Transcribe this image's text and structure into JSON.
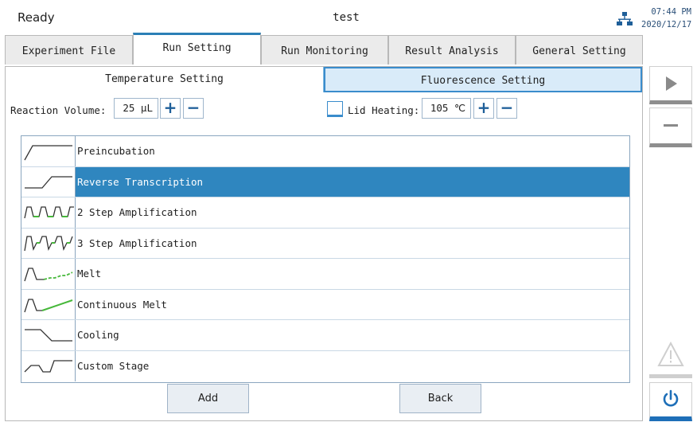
{
  "titlebar": {
    "status": "Ready",
    "title": "test",
    "time": "07:44 PM",
    "date": "2020/12/17"
  },
  "main_tabs": [
    {
      "label": "Experiment File"
    },
    {
      "label": "Run Setting"
    },
    {
      "label": "Run Monitoring"
    },
    {
      "label": "Result Analysis"
    },
    {
      "label": "General Setting"
    }
  ],
  "sub_tabs": {
    "temperature": "Temperature Setting",
    "fluorescence": "Fluorescence Setting"
  },
  "reaction": {
    "label": "Reaction Volume:",
    "value": "25 μL",
    "plus": "+",
    "minus": "−"
  },
  "lid": {
    "label": "Lid Heating:",
    "value": "105 ℃",
    "plus": "+",
    "minus": "−",
    "checked": false
  },
  "stages": [
    {
      "label": "Preincubation",
      "icon": "preincubation-profile-icon",
      "selected": false
    },
    {
      "label": "Reverse Transcription",
      "icon": "reverse-transcription-profile-icon",
      "selected": true
    },
    {
      "label": "2 Step Amplification",
      "icon": "two-step-amplification-profile-icon",
      "selected": false
    },
    {
      "label": "3 Step Amplification",
      "icon": "three-step-amplification-profile-icon",
      "selected": false
    },
    {
      "label": "Melt",
      "icon": "melt-profile-icon",
      "selected": false
    },
    {
      "label": "Continuous Melt",
      "icon": "continuous-melt-profile-icon",
      "selected": false
    },
    {
      "label": "Cooling",
      "icon": "cooling-profile-icon",
      "selected": false
    },
    {
      "label": "Custom Stage",
      "icon": "custom-stage-profile-icon",
      "selected": false
    }
  ],
  "buttons": {
    "add": "Add",
    "back": "Back"
  },
  "colors": {
    "accent": "#2f86bf",
    "selected_row": "#2f86bf",
    "fluor_tab": "#d9ebf9",
    "green": "#46b83a"
  }
}
